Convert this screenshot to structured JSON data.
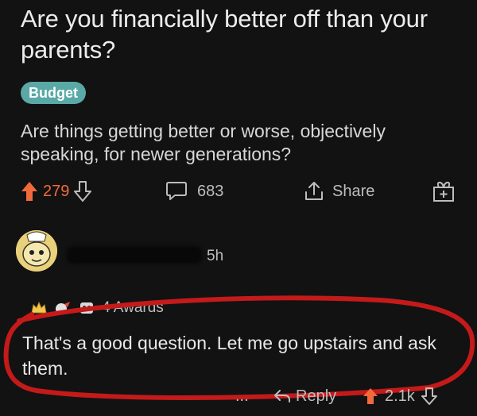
{
  "post": {
    "title": "Are you financially better off than your parents?",
    "flair": "Budget",
    "body": "Are things getting better or worse, objectively speaking, for newer generations?",
    "score": "279",
    "comments": "683",
    "share_label": "Share"
  },
  "comment": {
    "time": "5h",
    "awards_label": "4 Awards",
    "text": "That's a good question. Let me go upstairs and ask them.",
    "more_label": "...",
    "reply_label": "Reply",
    "score": "2.1k"
  },
  "colors": {
    "background": "#121212",
    "upvote": "#f26a3b",
    "flair": "#5aa9a6",
    "annotation_circle": "#c41a1a"
  }
}
